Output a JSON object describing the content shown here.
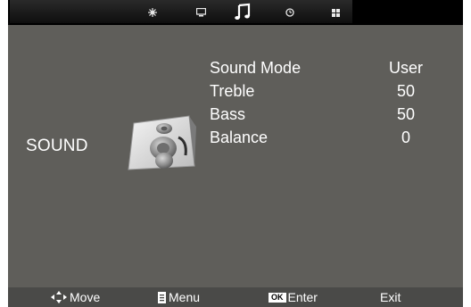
{
  "top_menu": {
    "icons": [
      "picture-settings-icon",
      "screen-icon",
      "music-note-icon",
      "clock-icon",
      "grid-icon"
    ],
    "active": "music-note-icon"
  },
  "section": {
    "title": "SOUND"
  },
  "settings": [
    {
      "label": "Sound Mode",
      "value": "User"
    },
    {
      "label": "Treble",
      "value": "50"
    },
    {
      "label": "Bass",
      "value": "50"
    },
    {
      "label": "Balance",
      "value": "0"
    }
  ],
  "footer": {
    "move": "Move",
    "menu": "Menu",
    "ok_key": "OK",
    "enter": "Enter",
    "exit": "Exit"
  },
  "colors": {
    "background": "#5f5e5a",
    "topbar": "#000000",
    "footer": "#4a4a48",
    "text": "#ffffff"
  }
}
